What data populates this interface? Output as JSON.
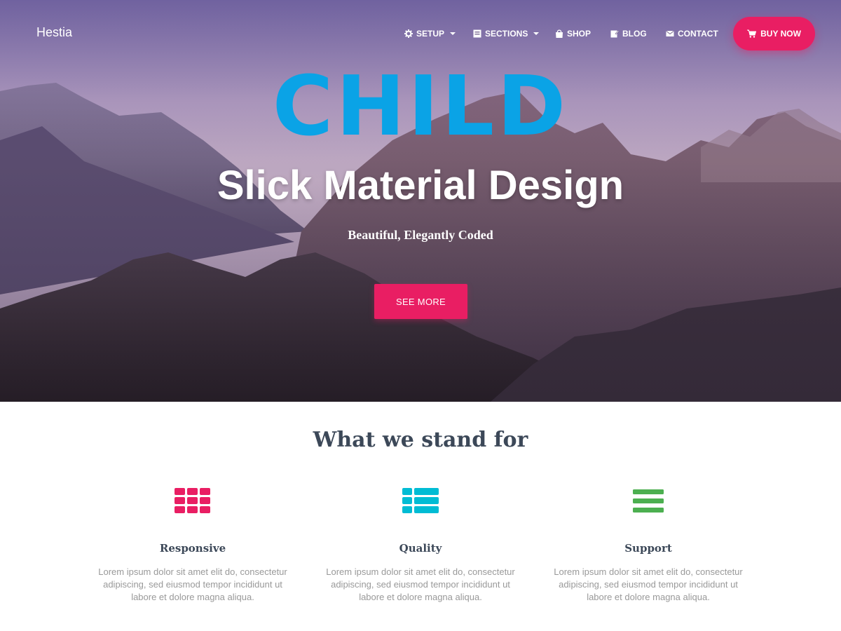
{
  "brand": "Hestia",
  "nav": {
    "items": [
      {
        "label": "SETUP",
        "icon": "gear-icon",
        "dropdown": true
      },
      {
        "label": "SECTIONS",
        "icon": "sections-icon",
        "dropdown": true
      },
      {
        "label": "SHOP",
        "icon": "bag-icon",
        "dropdown": false
      },
      {
        "label": "BLOG",
        "icon": "edit-icon",
        "dropdown": false
      },
      {
        "label": "CONTACT",
        "icon": "envelope-icon",
        "dropdown": false
      }
    ],
    "cta": {
      "label": "BUY NOW",
      "icon": "cart-icon",
      "color": "#e91e63"
    }
  },
  "hero": {
    "overlay": "CHILD",
    "overlay_color": "#0aa3e6",
    "title": "Slick Material Design",
    "subtitle": "Beautiful, Elegantly Coded",
    "button": "SEE MORE"
  },
  "features": {
    "title": "What we stand for",
    "items": [
      {
        "title": "Responsive",
        "icon": "grid-icon",
        "color": "#e91e63",
        "text": "Lorem ipsum dolor sit amet elit do, consectetur adipiscing, sed eiusmod tempor incididunt ut labore et dolore magna aliqua."
      },
      {
        "title": "Quality",
        "icon": "list-icon",
        "color": "#00bcd4",
        "text": "Lorem ipsum dolor sit amet elit do, consectetur adipiscing, sed eiusmod tempor incididunt ut labore et dolore magna aliqua."
      },
      {
        "title": "Support",
        "icon": "menu-icon",
        "color": "#4caf50",
        "text": "Lorem ipsum dolor sit amet elit do, consectetur adipiscing, sed eiusmod tempor incididunt ut labore et dolore magna aliqua."
      }
    ]
  }
}
